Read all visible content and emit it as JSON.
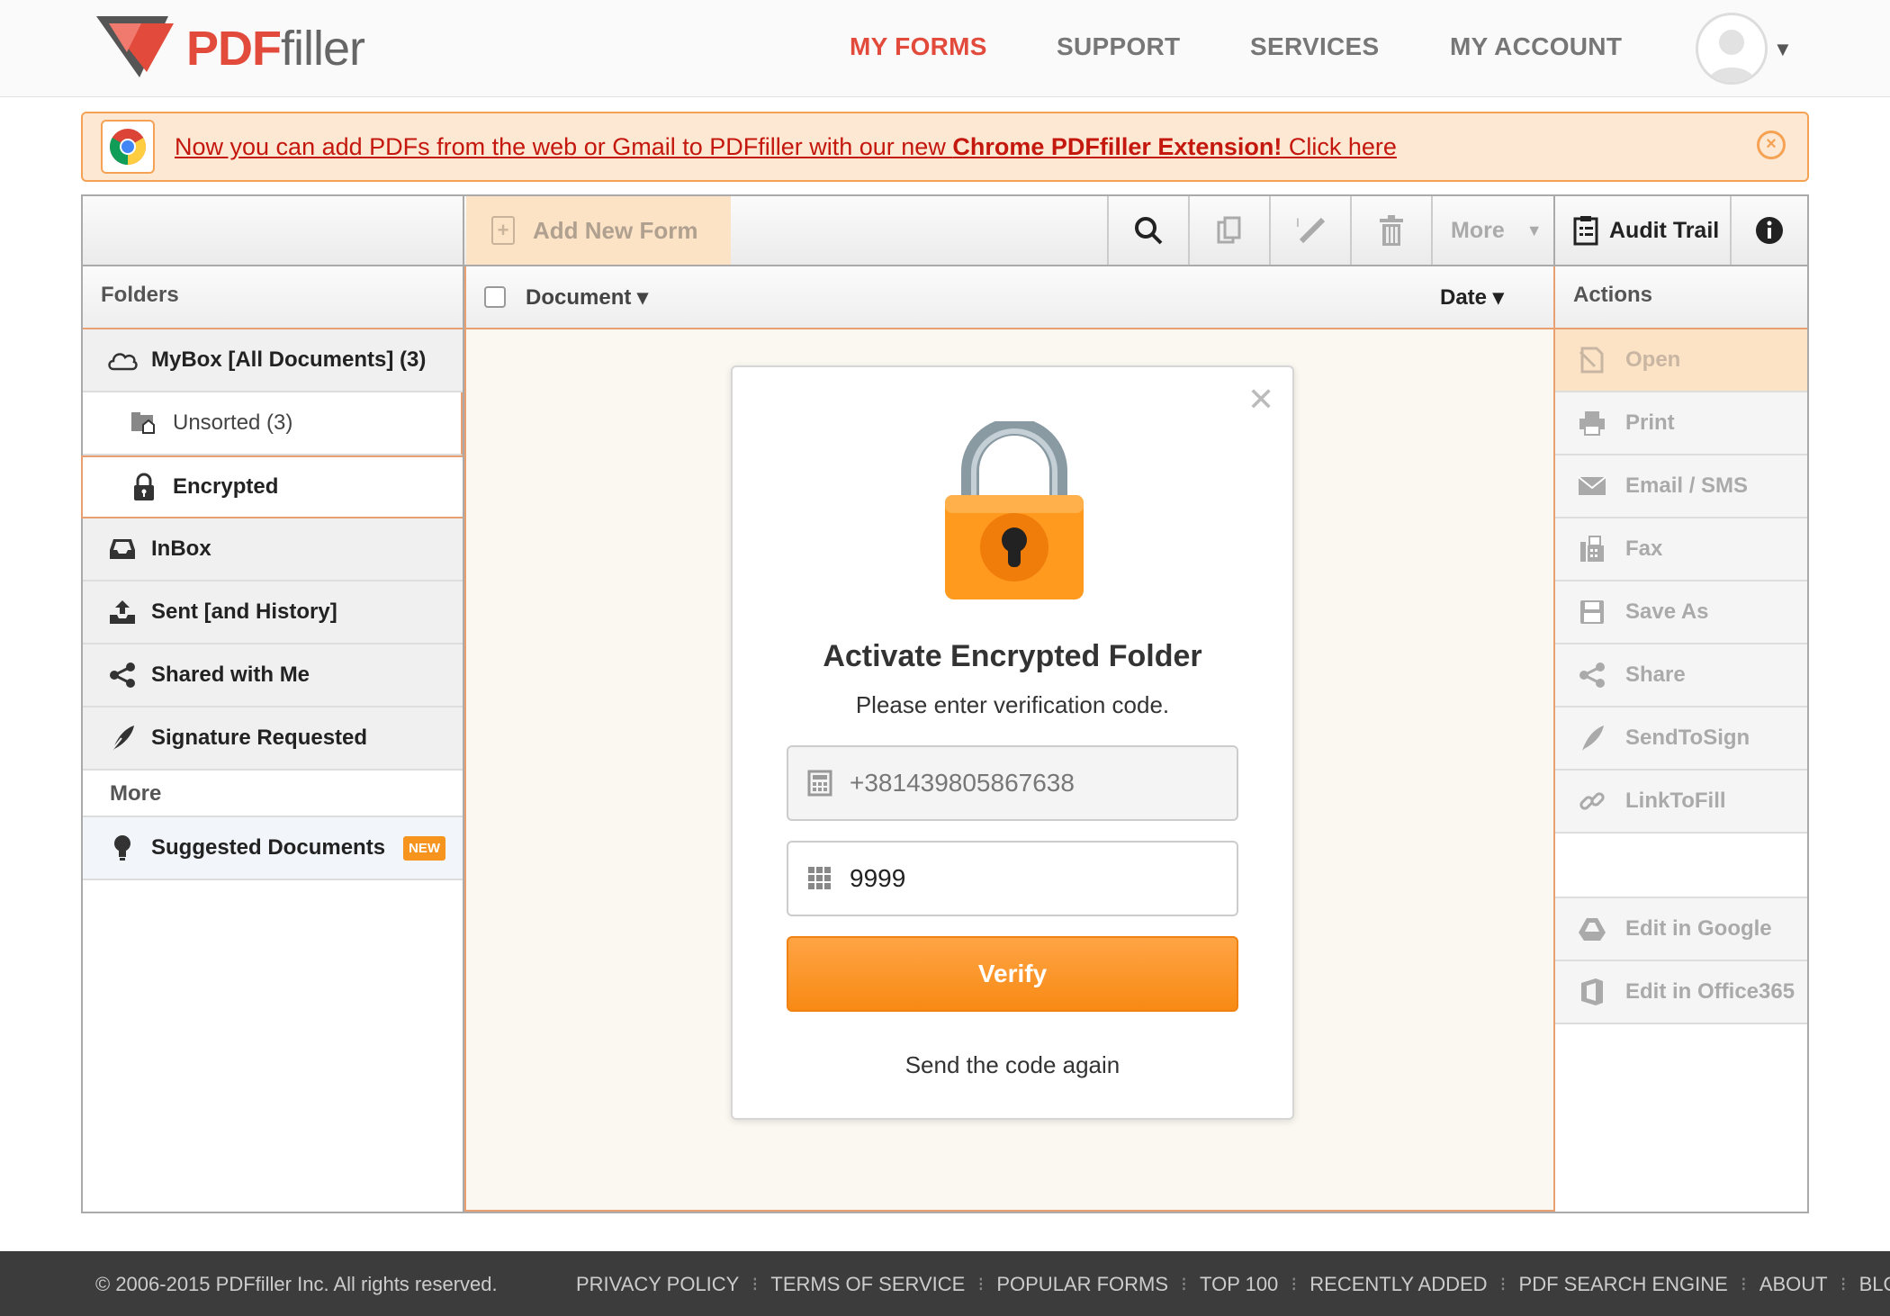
{
  "header": {
    "logo_pdf": "PDF",
    "logo_filler": "filler",
    "nav": [
      {
        "label": "MY FORMS",
        "active": true
      },
      {
        "label": "SUPPORT",
        "active": false
      },
      {
        "label": "SERVICES",
        "active": false
      },
      {
        "label": "MY ACCOUNT",
        "active": false
      }
    ],
    "avatar_icon": "user-avatar-icon",
    "caret_icon": "chevron-down-icon"
  },
  "banner": {
    "text_before": "Now you can add PDFs from the web or Gmail to PDFfiller with our new ",
    "text_bold": "Chrome PDFfiller Extension!",
    "text_link": " Click here",
    "icon": "chrome-icon",
    "close_icon": "close-circle-icon"
  },
  "toolbar": {
    "add_new_label": "Add New Form",
    "icons": [
      "search-icon",
      "copy-icon",
      "edit-icon",
      "trash-icon"
    ],
    "more_label": "More",
    "audit_label": "Audit Trail",
    "info_icon": "info-icon"
  },
  "folders": {
    "header": "Folders",
    "items": [
      {
        "label": "MyBox [All Documents] (3)",
        "icon": "cloud-icon"
      },
      {
        "label": "Unsorted  (3)",
        "icon": "unsorted-folder-icon"
      },
      {
        "label": "Encrypted",
        "icon": "lock-icon"
      },
      {
        "label": "InBox",
        "icon": "inbox-icon"
      },
      {
        "label": "Sent [and History]",
        "icon": "outbox-icon"
      },
      {
        "label": "Shared with Me",
        "icon": "share-icon"
      },
      {
        "label": "Signature Requested",
        "icon": "quill-icon"
      }
    ],
    "more_label": "More",
    "suggested_label": "Suggested Documents",
    "suggested_badge": "NEW"
  },
  "documents": {
    "col_document": "Document ▾",
    "col_date": "Date ▾"
  },
  "actions": {
    "header": "Actions",
    "items": [
      {
        "label": "Open",
        "icon": "open-icon"
      },
      {
        "label": "Print",
        "icon": "printer-icon"
      },
      {
        "label": "Email / SMS",
        "icon": "envelope-icon"
      },
      {
        "label": "Fax",
        "icon": "fax-icon"
      },
      {
        "label": "Save As",
        "icon": "save-icon"
      },
      {
        "label": "Share",
        "icon": "share-icon"
      },
      {
        "label": "SendToSign",
        "icon": "quill-icon"
      },
      {
        "label": "LinkToFill",
        "icon": "link-icon"
      }
    ],
    "items2": [
      {
        "label": "Edit in Google",
        "icon": "google-drive-icon"
      },
      {
        "label": "Edit in Office365",
        "icon": "office-icon"
      }
    ]
  },
  "modal": {
    "title": "Activate Encrypted Folder",
    "subtitle": "Please enter verification code.",
    "phone_value": "+381439805867638",
    "code_value": "9999",
    "verify_label": "Verify",
    "resend_label": "Send the code again",
    "colors": {
      "accent": "#f88a14",
      "lock": "#ff9a1f"
    }
  },
  "footer": {
    "copyright": "© 2006-2015 PDFfiller Inc. All rights reserved.",
    "links": [
      "PRIVACY POLICY",
      "TERMS OF SERVICE",
      "POPULAR FORMS",
      "TOP 100",
      "RECENTLY ADDED",
      "PDF SEARCH ENGINE",
      "ABOUT",
      "BLOG"
    ]
  },
  "colors": {
    "brand_red": "#e24a3c",
    "orange": "#f5a254",
    "banner_bg": "#fde8d3"
  }
}
